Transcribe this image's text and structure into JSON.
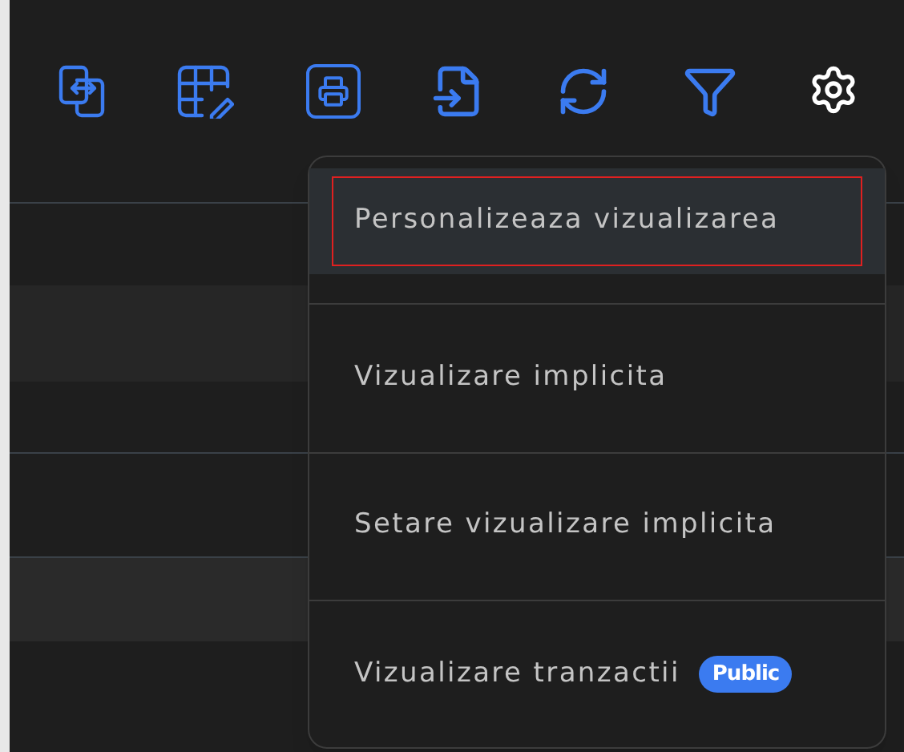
{
  "menu": {
    "items": [
      {
        "label": "Personalizeaza vizualizarea",
        "selected": true
      },
      {
        "label": "Vizualizare implicita",
        "selected": false
      },
      {
        "label": "Setare vizualizare implicita",
        "selected": false
      },
      {
        "label": "Vizualizare tranzactii",
        "selected": false,
        "badge": "Public"
      }
    ]
  }
}
